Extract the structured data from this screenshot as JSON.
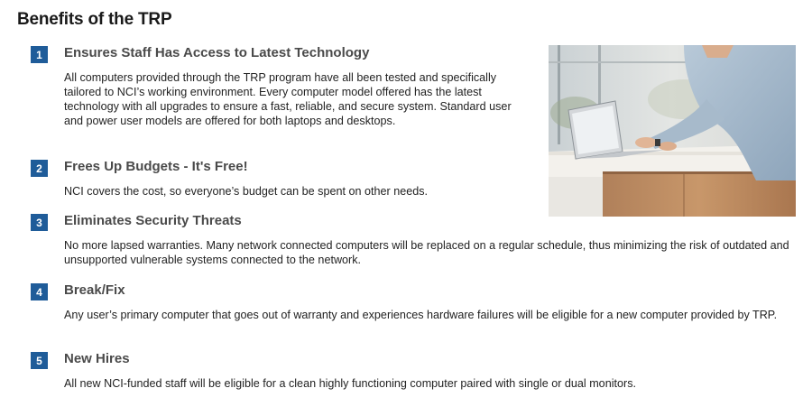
{
  "page": {
    "title": "Benefits of the TRP"
  },
  "benefits": [
    {
      "number": "1",
      "heading": "Ensures Staff Has Access to Latest Technology",
      "body": "All computers provided through the TRP program have all been tested and specifically tailored to NCI’s working environment. Every computer model offered has the latest technology with all upgrades to ensure a fast, reliable, and secure system. Standard user and power user models are offered for both laptops and desktops."
    },
    {
      "number": "2",
      "heading": "Frees Up Budgets - It's Free!",
      "body": "NCI covers the cost, so everyone’s budget can be spent on other needs."
    },
    {
      "number": "3",
      "heading": "Eliminates Security Threats",
      "body": "No more lapsed warranties. Many network connected computers will be replaced on a regular schedule, thus minimizing the risk of outdated and unsupported vulnerable systems connected to the network."
    },
    {
      "number": "4",
      "heading": "Break/Fix",
      "body": "Any user’s primary computer that goes out of warranty and experiences hardware failures will be eligible for a new computer provided by TRP."
    },
    {
      "number": "5",
      "heading": "New Hires",
      "body": "All new NCI-funded staff will be eligible for a clean highly functioning computer paired with single or dual monitors."
    }
  ],
  "colors": {
    "badge": "#1f5c99",
    "heading": "#4a4a4a",
    "body_text": "#222222"
  }
}
